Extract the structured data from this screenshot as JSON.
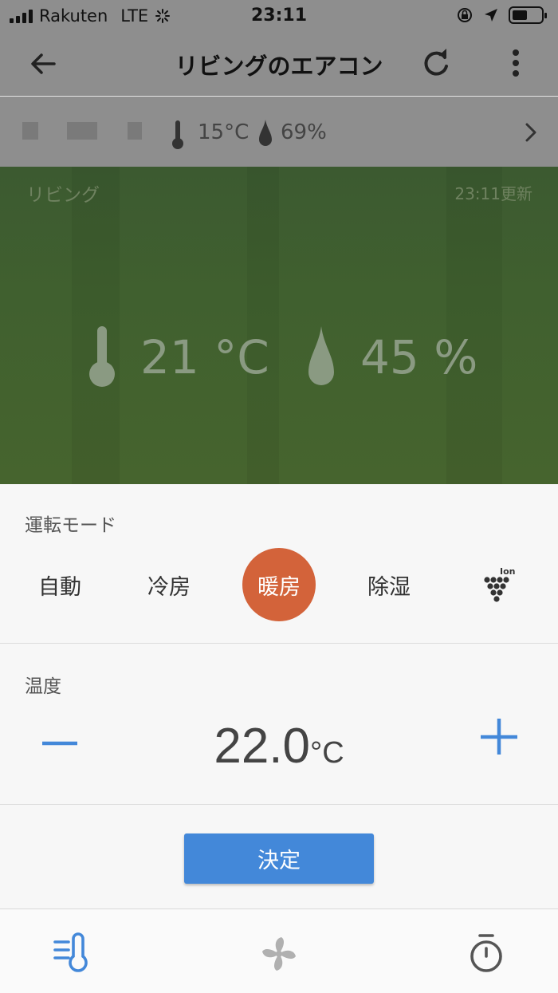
{
  "status_bar": {
    "carrier": "Rakuten",
    "network": "LTE",
    "time": "23:11"
  },
  "app_bar": {
    "title": "リビングのエアコン"
  },
  "sub_bar": {
    "outdoor_temp": "15°C",
    "outdoor_humidity": "69%"
  },
  "hero": {
    "room": "リビング",
    "updated": "23:11更新",
    "room_temp": "21 °C",
    "room_humidity": "45 %"
  },
  "mode_section": {
    "label": "運転モード",
    "modes": [
      {
        "label": "自動",
        "active": false
      },
      {
        "label": "冷房",
        "active": false
      },
      {
        "label": "暖房",
        "active": true
      },
      {
        "label": "除湿",
        "active": false
      }
    ],
    "ion_label": "Ion"
  },
  "temp_section": {
    "label": "温度",
    "value": "22.0",
    "unit": "°C"
  },
  "confirm_label": "決定",
  "colors": {
    "accent_blue": "#4388d9",
    "active_mode": "#d3633a",
    "hero_green": "#40602f"
  },
  "icons": [
    "back-arrow-icon",
    "refresh-icon",
    "more-vert-icon",
    "thermometer-icon",
    "droplet-icon",
    "chevron-right-icon",
    "ion-icon",
    "minus-icon",
    "plus-icon",
    "thermostat-tab-icon",
    "fan-tab-icon",
    "timer-tab-icon"
  ]
}
